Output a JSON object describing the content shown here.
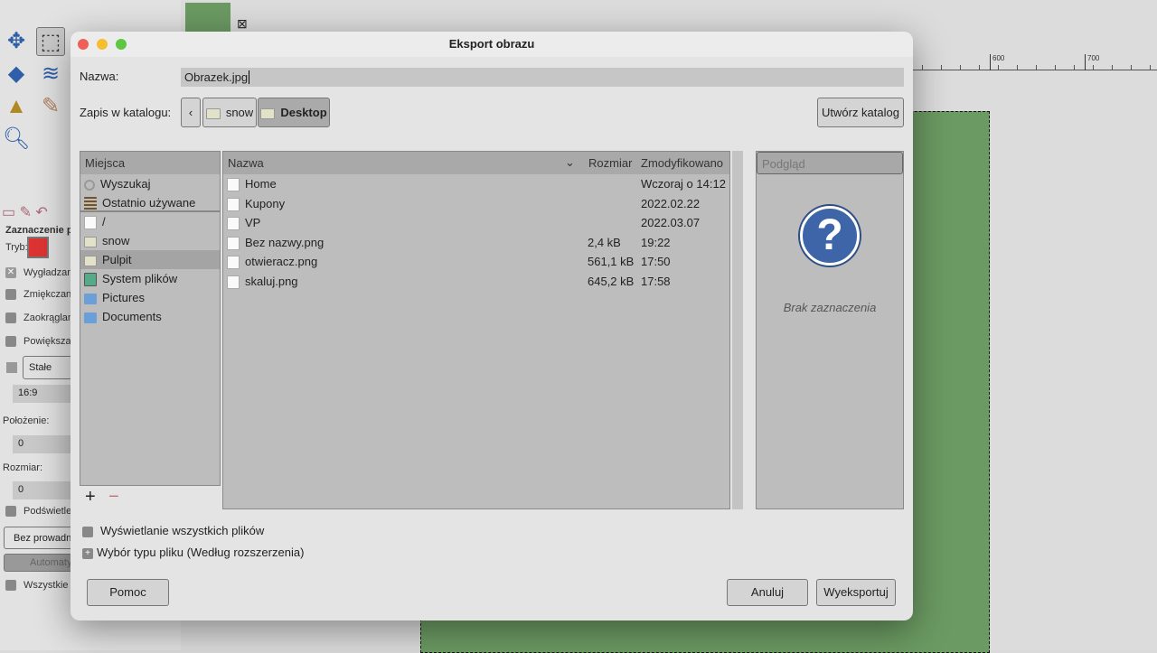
{
  "gimp": {
    "tool_options_title": "Zaznaczenie p",
    "mode_label": "Tryb:",
    "options": [
      "Wygładzan",
      "Zmiękczani",
      "Zaokrąglan",
      "Powiększar"
    ],
    "fixed_dropdown": "Stałe",
    "ratio_value": "16:9",
    "position_label": "Położenie:",
    "position_value": "0",
    "size_label": "Rozmiar:",
    "size_value": "0",
    "highlight": "Podświetle",
    "guides_dropdown": "Bez prowadn",
    "auto_button": "Automaty",
    "all_layers": "Wszystkie w",
    "ruler_labels": [
      "600",
      "700"
    ],
    "image_color": "#6b9a62"
  },
  "dialog": {
    "title": "Eksport obrazu",
    "name_label": "Nazwa:",
    "name_value": "Obrazek.jpg",
    "folder_label": "Zapis w katalogu:",
    "path": [
      "snow",
      "Desktop"
    ],
    "create_folder": "Utwórz katalog",
    "places_header": "Miejsca",
    "places": [
      {
        "label": "Wyszukaj",
        "icon": "search-icon"
      },
      {
        "label": "Ostatnio używane",
        "icon": "recent-icon"
      },
      {
        "label": "/",
        "icon": "file-icon"
      },
      {
        "label": "snow",
        "icon": "folder-icon"
      },
      {
        "label": "Pulpit",
        "icon": "folder-icon",
        "selected": true
      },
      {
        "label": "System plików",
        "icon": "drive-icon"
      },
      {
        "label": "Pictures",
        "icon": "folder-blue-icon"
      },
      {
        "label": "Documents",
        "icon": "folder-blue-icon"
      }
    ],
    "columns": {
      "name": "Nazwa",
      "size": "Rozmiar",
      "modified": "Zmodyfikowano"
    },
    "files": [
      {
        "name": "Home",
        "size": "",
        "modified": "Wczoraj o 14:12"
      },
      {
        "name": "Kupony",
        "size": "",
        "modified": "2022.02.22"
      },
      {
        "name": "VP",
        "size": "",
        "modified": "2022.03.07"
      },
      {
        "name": "Bez nazwy.png",
        "size": "2,4 kB",
        "modified": "19:22"
      },
      {
        "name": "otwieracz.png",
        "size": "561,1 kB",
        "modified": "17:50"
      },
      {
        "name": "skaluj.png",
        "size": "645,2 kB",
        "modified": "17:58"
      }
    ],
    "preview_header": "Podgląd",
    "preview_empty": "Brak zaznaczenia",
    "show_all_files": "Wyświetlanie wszystkich plików",
    "file_type": "Wybór typu pliku (Według rozszerzenia)",
    "help": "Pomoc",
    "cancel": "Anuluj",
    "export": "Wyeksportuj"
  }
}
